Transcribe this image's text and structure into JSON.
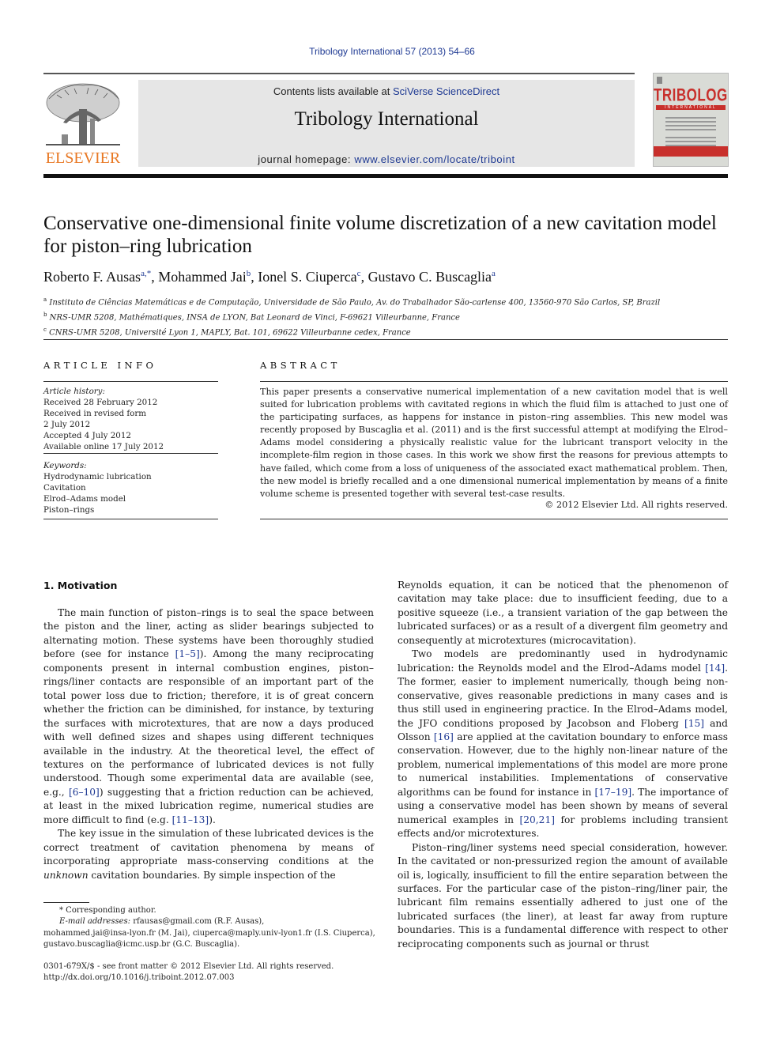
{
  "journal_ref": "Tribology International 57 (2013) 54–66",
  "masthead": {
    "contents_prefix": "Contents lists available at ",
    "contents_link": "SciVerse ScienceDirect",
    "journal_name": "Tribology International",
    "homepage_prefix": "journal homepage: ",
    "homepage_link": "www.elsevier.com/locate/triboint",
    "publisher_logo_text": "ELSEVIER",
    "cover_title": "TRIBOLOGY",
    "cover_subtitle": "INTERNATIONAL",
    "colors": {
      "publisher_orange": "#e87722",
      "link_blue": "#1f3a93",
      "cover_red": "#c8302c",
      "masthead_gray": "#e6e6e6"
    }
  },
  "article": {
    "title": "Conservative one-dimensional finite volume discretization of a new cavitation model for piston–ring lubrication",
    "authors": [
      {
        "name": "Roberto F. Ausas",
        "sup": "a,*",
        "sep": ", "
      },
      {
        "name": "Mohammed Jai",
        "sup": "b",
        "sep": ", "
      },
      {
        "name": "Ionel S. Ciuperca",
        "sup": "c",
        "sep": ", "
      },
      {
        "name": "Gustavo C. Buscaglia",
        "sup": "a",
        "sep": ""
      }
    ],
    "affiliations": [
      {
        "mark": "a",
        "text": "Instituto de Ciências Matemáticas e de Computação, Universidade de São Paulo, Av. do Trabalhador São-carlense 400, 13560-970 São Carlos, SP, Brazil"
      },
      {
        "mark": "b",
        "text": "NRS-UMR 5208, Mathématiques, INSA de LYON, Bat Leonard de Vinci, F-69621 Villeurbanne, France"
      },
      {
        "mark": "c",
        "text": "CNRS-UMR 5208, Université Lyon 1, MAPLY, Bat. 101, 69622 Villeurbanne cedex, France"
      }
    ]
  },
  "article_info": {
    "heading": "ARTICLE INFO",
    "history_label": "Article history:",
    "history": [
      "Received 28 February 2012",
      "Received in revised form",
      "2 July 2012",
      "Accepted 4 July 2012",
      "Available online 17 July 2012"
    ],
    "keywords_label": "Keywords:",
    "keywords": [
      "Hydrodynamic lubrication",
      "Cavitation",
      "Elrod–Adams model",
      "Piston–rings"
    ]
  },
  "abstract": {
    "heading": "ABSTRACT",
    "text": "This paper presents a conservative numerical implementation of a new cavitation model that is well suited for lubrication problems with cavitated regions in which the fluid film is attached to just one of the participating surfaces, as happens for instance in piston–ring assemblies. This new model was recently proposed by Buscaglia et al. (2011) and is the first successful attempt at modifying the Elrod–Adams model considering a physically realistic value for the lubricant transport velocity in the incomplete-film region in those cases. In this work we show first the reasons for previous attempts to have failed, which come from a loss of uniqueness of the associated exact mathematical problem. Then, the new model is briefly recalled and a one dimensional numerical implementation by means of a finite volume scheme is presented together with several test-case results.",
    "copyright": "© 2012 Elsevier Ltd. All rights reserved."
  },
  "body": {
    "section1_heading": "1.  Motivation",
    "left_paragraphs": [
      [
        {
          "t": "The main function of piston–rings is to seal the space between the piston and the liner, acting as slider bearings subjected to alternating motion. These systems have been thoroughly studied before (see for instance "
        },
        {
          "ref": "[1–5]"
        },
        {
          "t": "). Among the many reciprocating components present in internal combustion engines, piston–rings/liner contacts are responsible of an important part of the total power loss due to friction; therefore, it is of great concern whether the friction can be diminished, for instance, by texturing the surfaces with microtextures, that are now a days produced with well defined sizes and shapes using different techniques available in the industry. At the theoretical level, the effect of textures on the performance of lubricated devices is not fully understood. Though some experimental data are available (see, e.g., "
        },
        {
          "ref": "[6–10]"
        },
        {
          "t": ") suggesting that a friction reduction can be achieved, at least in the mixed lubrication regime, numerical studies are more difficult to find (e.g. "
        },
        {
          "ref": "[11–13]"
        },
        {
          "t": ")."
        }
      ],
      [
        {
          "t": "The key issue in the simulation of these lubricated devices is the correct treatment of cavitation phenomena by means of incorporating appropriate mass-conserving conditions at the "
        },
        {
          "em": "unknown"
        },
        {
          "t": " cavitation boundaries. By simple inspection of the"
        }
      ]
    ],
    "right_paragraphs": [
      [
        {
          "t": "Reynolds equation, it can be noticed that the phenomenon of cavitation may take place: due to insufficient feeding, due to a positive squeeze (i.e., a transient variation of the gap between the lubricated surfaces) or as a result of a divergent film geometry and consequently at microtextures (microcavitation)."
        }
      ],
      [
        {
          "t": "Two models are predominantly used in hydrodynamic lubrication: the Reynolds model and the Elrod–Adams model "
        },
        {
          "ref": "[14]"
        },
        {
          "t": ". The former, easier to implement numerically, though being non-conservative, gives reasonable predictions in many cases and is thus still used in engineering practice. In the Elrod–Adams model, the JFO conditions proposed by Jacobson and Floberg "
        },
        {
          "ref": "[15]"
        },
        {
          "t": " and Olsson "
        },
        {
          "ref": "[16]"
        },
        {
          "t": " are applied at the cavitation boundary to enforce mass conservation. However, due to the highly non-linear nature of the problem, numerical implementations of this model are more prone to numerical instabilities. Implementations of conservative algorithms can be found for instance in "
        },
        {
          "ref": "[17–19]"
        },
        {
          "t": ". The importance of using a conservative model has been shown by means of several numerical examples in "
        },
        {
          "ref": "[20,21]"
        },
        {
          "t": " for problems including transient effects and/or microtextures."
        }
      ],
      [
        {
          "t": "Piston–ring/liner systems need special consideration, however. In the cavitated or non-pressurized region the amount of available oil is, logically, insufficient to fill the entire separation between the surfaces. For the particular case of the piston–ring/liner pair, the lubricant film remains essentially adhered to just one of the lubricated surfaces (the liner), at least far away from rupture boundaries. This is a fundamental difference with respect to other reciprocating components such as journal or thrust"
        }
      ]
    ]
  },
  "footnotes": {
    "corresponding": "* Corresponding author.",
    "email_label": "E-mail addresses:",
    "email_line1": " rfausas@gmail.com (R.F. Ausas),",
    "email_line2": "mohammed.jai@insa-lyon.fr (M. Jai), ciuperca@maply.univ-lyon1.fr (I.S. Ciuperca),",
    "email_line3": "gustavo.buscaglia@icmc.usp.br (G.C. Buscaglia).",
    "front_matter": "0301-679X/$ - see front matter © 2012 Elsevier Ltd. All rights reserved.",
    "doi": "http://dx.doi.org/10.1016/j.triboint.2012.07.003"
  }
}
